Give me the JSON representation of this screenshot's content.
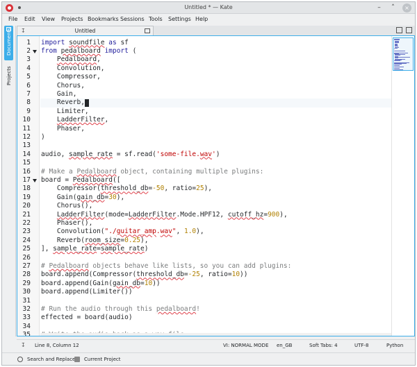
{
  "window": {
    "title": "Untitled * — Kate",
    "buttons": {
      "minimize": "–",
      "maximize": "˄",
      "close": "×"
    }
  },
  "menu": [
    "File",
    "Edit",
    "View",
    "Projects",
    "Bookmarks",
    "Sessions",
    "Tools",
    "Settings",
    "Help"
  ],
  "sidebar": {
    "documents": "Documents",
    "projects": "Projects"
  },
  "tab": {
    "label": "Untitled"
  },
  "editor": {
    "current_line": 8,
    "line_numbers": [
      "1",
      "2",
      "3",
      "4",
      "5",
      "6",
      "7",
      "8",
      "9",
      "10",
      "11",
      "12",
      "13",
      "14",
      "15",
      "16",
      "17",
      "18",
      "19",
      "20",
      "21",
      "22",
      "23",
      "24",
      "25",
      "26",
      "27",
      "28",
      "29",
      "30",
      "31",
      "32",
      "33",
      "34",
      "35"
    ],
    "folded_lines": [
      2,
      17
    ],
    "lines": [
      [
        {
          "t": "import",
          "c": "kw"
        },
        {
          "t": " "
        },
        {
          "t": "soundfile",
          "c": "sp"
        },
        {
          "t": " "
        },
        {
          "t": "as",
          "c": "kw"
        },
        {
          "t": " sf"
        }
      ],
      [
        {
          "t": "from",
          "c": "kw"
        },
        {
          "t": " "
        },
        {
          "t": "pedalboard",
          "c": "sp"
        },
        {
          "t": " "
        },
        {
          "t": "import",
          "c": "kw"
        },
        {
          "t": " ("
        }
      ],
      [
        {
          "t": "    "
        },
        {
          "t": "Pedalboard",
          "c": "sp"
        },
        {
          "t": ","
        }
      ],
      [
        {
          "t": "    Convolution,"
        }
      ],
      [
        {
          "t": "    Compressor,"
        }
      ],
      [
        {
          "t": "    Chorus,"
        }
      ],
      [
        {
          "t": "    Gain,"
        }
      ],
      [
        {
          "t": "    Reverb,"
        }
      ],
      [
        {
          "t": "    Limiter,"
        }
      ],
      [
        {
          "t": "    "
        },
        {
          "t": "LadderFilter",
          "c": "sp"
        },
        {
          "t": ","
        }
      ],
      [
        {
          "t": "    Phaser,"
        }
      ],
      [
        {
          "t": ")"
        }
      ],
      [],
      [
        {
          "t": "audio, "
        },
        {
          "t": "sample_rate",
          "c": "sp"
        },
        {
          "t": " = sf.read("
        },
        {
          "t": "'some-file.",
          "c": "str"
        },
        {
          "t": "wav",
          "c": "str sp"
        },
        {
          "t": "'",
          "c": "str"
        },
        {
          "t": ")"
        }
      ],
      [],
      [
        {
          "t": "# Make a ",
          "c": "cm"
        },
        {
          "t": "Pedalboard",
          "c": "cm sp"
        },
        {
          "t": " object, containing multiple plugins:",
          "c": "cm"
        }
      ],
      [
        {
          "t": "board = "
        },
        {
          "t": "Pedalboard",
          "c": "sp"
        },
        {
          "t": "(["
        }
      ],
      [
        {
          "t": "    Compressor("
        },
        {
          "t": "threshold_db",
          "c": "sp"
        },
        {
          "t": "="
        },
        {
          "t": "-50",
          "c": "num"
        },
        {
          "t": ", ratio="
        },
        {
          "t": "25",
          "c": "num"
        },
        {
          "t": "),"
        }
      ],
      [
        {
          "t": "    Gain("
        },
        {
          "t": "gain_db",
          "c": "sp"
        },
        {
          "t": "="
        },
        {
          "t": "30",
          "c": "num"
        },
        {
          "t": "),"
        }
      ],
      [
        {
          "t": "    Chorus(),"
        }
      ],
      [
        {
          "t": "    "
        },
        {
          "t": "LadderFilter",
          "c": "sp"
        },
        {
          "t": "(mode="
        },
        {
          "t": "LadderFilter",
          "c": "sp"
        },
        {
          "t": ".Mode.HPF12, "
        },
        {
          "t": "cutoff_hz",
          "c": "sp"
        },
        {
          "t": "="
        },
        {
          "t": "900",
          "c": "num"
        },
        {
          "t": "),"
        }
      ],
      [
        {
          "t": "    Phaser(),"
        }
      ],
      [
        {
          "t": "    Convolution("
        },
        {
          "t": "\"./",
          "c": "str"
        },
        {
          "t": "guitar_amp",
          "c": "str sp"
        },
        {
          "t": ".",
          "c": "str"
        },
        {
          "t": "wav",
          "c": "str sp"
        },
        {
          "t": "\"",
          "c": "str"
        },
        {
          "t": ", "
        },
        {
          "t": "1.0",
          "c": "num"
        },
        {
          "t": "),"
        }
      ],
      [
        {
          "t": "    Reverb("
        },
        {
          "t": "room_size",
          "c": "sp"
        },
        {
          "t": "="
        },
        {
          "t": "0.25",
          "c": "num"
        },
        {
          "t": "),"
        }
      ],
      [
        {
          "t": "], "
        },
        {
          "t": "sample_rate",
          "c": "sp"
        },
        {
          "t": "="
        },
        {
          "t": "sample_rate",
          "c": "sp"
        },
        {
          "t": ")"
        }
      ],
      [],
      [
        {
          "t": "# ",
          "c": "cm"
        },
        {
          "t": "Pedalboard",
          "c": "cm sp"
        },
        {
          "t": " objects behave like lists, so you can add plugins:",
          "c": "cm"
        }
      ],
      [
        {
          "t": "board.append(Compressor("
        },
        {
          "t": "threshold_db",
          "c": "sp"
        },
        {
          "t": "="
        },
        {
          "t": "-25",
          "c": "num"
        },
        {
          "t": ", ratio="
        },
        {
          "t": "10",
          "c": "num"
        },
        {
          "t": "))"
        }
      ],
      [
        {
          "t": "board.append(Gain("
        },
        {
          "t": "gain_db",
          "c": "sp"
        },
        {
          "t": "="
        },
        {
          "t": "10",
          "c": "num"
        },
        {
          "t": "))"
        }
      ],
      [
        {
          "t": "board.append(Limiter())"
        }
      ],
      [],
      [
        {
          "t": "# Run the audio through this ",
          "c": "cm"
        },
        {
          "t": "pedalboard",
          "c": "cm sp"
        },
        {
          "t": "!",
          "c": "cm"
        }
      ],
      [
        {
          "t": "effected = board(audio)"
        }
      ],
      [],
      [
        {
          "t": "# Write the audio back as a ",
          "c": "cm"
        },
        {
          "t": "wav",
          "c": "cm sp"
        },
        {
          "t": " file:",
          "c": "cm"
        }
      ]
    ]
  },
  "statusbar": {
    "position": "Line 8, Column 12",
    "mode": "VI: NORMAL MODE",
    "dictionary": "en_GB",
    "indent": "Soft Tabs: 4",
    "encoding": "UTF-8",
    "language": "Python"
  },
  "bottom": {
    "search": "Search and Replace",
    "project": "Current Project"
  }
}
